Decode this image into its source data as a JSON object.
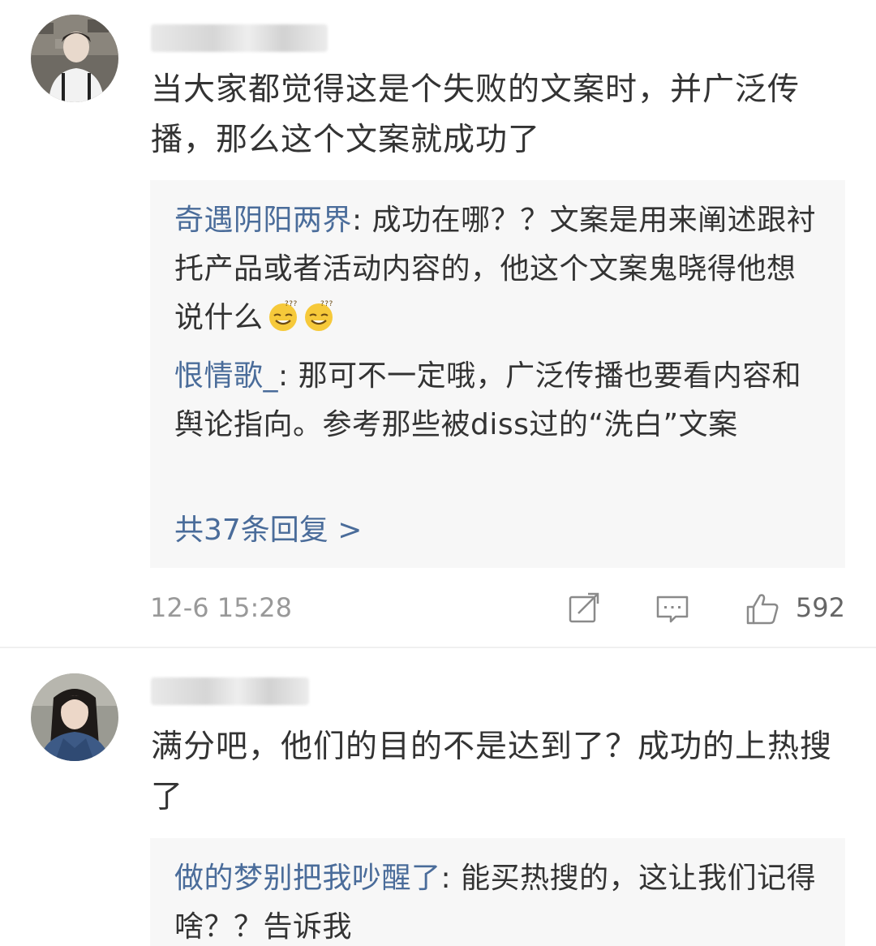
{
  "comments": [
    {
      "avatar_icon": "user-avatar-photo",
      "text": "当大家都觉得这是个失败的文案时，并广泛传播，那么这个文案就成功了",
      "replies": [
        {
          "nick": "奇遇阴阳两界",
          "sep": ": ",
          "text": "成功在哪？？文案是用来阐述跟衬托产品或者活动内容的，他这个文案鬼晓得他想说什么",
          "emoji_count": 2,
          "emoji_icon": "squinting-smile-emoji"
        },
        {
          "nick": "恨情歌_",
          "sep": ": ",
          "text": "那可不一定哦，广泛传播也要看内容和舆论指向。参考那些被diss过的“洗白”文案"
        }
      ],
      "more_replies": "共37条回复 >",
      "timestamp": "12-6 15:28",
      "like_count": "592"
    },
    {
      "avatar_icon": "user-avatar-photo",
      "text": "满分吧，他们的目的不是达到了？成功的上热搜了",
      "replies": [
        {
          "nick": "做的梦别把我吵醒了",
          "sep": ": ",
          "text": "能买热搜的，这让我们记得啥？？告诉我"
        }
      ]
    }
  ],
  "colors": {
    "link": "#4a6c9a",
    "reply_bg": "#f7f7f7",
    "meta_text": "#999999"
  }
}
